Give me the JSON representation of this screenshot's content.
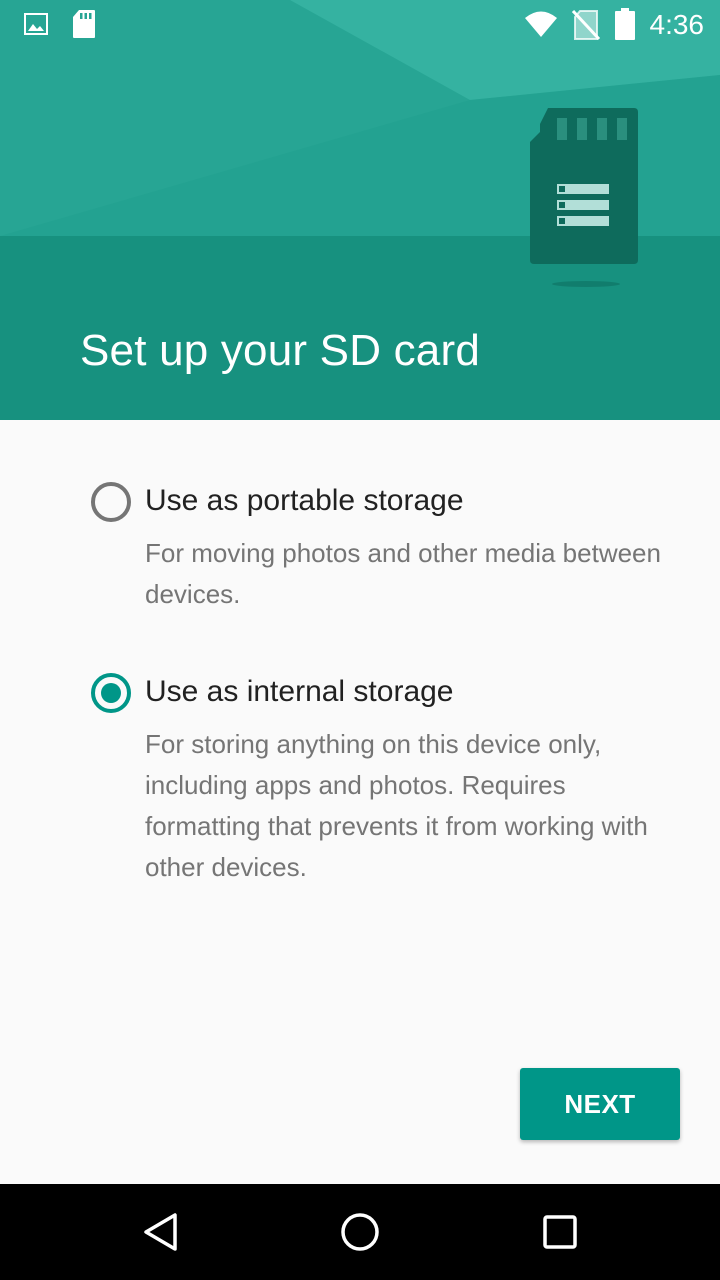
{
  "status_bar": {
    "time": "4:36",
    "left_icons": [
      "image-icon",
      "sd-card-icon"
    ],
    "right_icons": [
      "wifi-icon",
      "no-sim-icon",
      "battery-icon"
    ]
  },
  "header": {
    "title": "Set up your SD card",
    "illustration": "sd-card-illustration"
  },
  "options": [
    {
      "title": "Use as portable storage",
      "description": "For moving photos and other media between devices.",
      "selected": false
    },
    {
      "title": "Use as internal storage",
      "description": "For storing anything on this device only, including apps and photos. Requires formatting that prevents it from working with other devices.",
      "selected": true
    }
  ],
  "next_button": {
    "label": "NEXT"
  },
  "nav_bar": {
    "buttons": [
      "back-icon",
      "home-icon",
      "recents-icon"
    ]
  },
  "colors": {
    "accent": "#009688",
    "header_upper": "#27a594",
    "header_lower": "#17917f",
    "background": "#fafafa"
  }
}
